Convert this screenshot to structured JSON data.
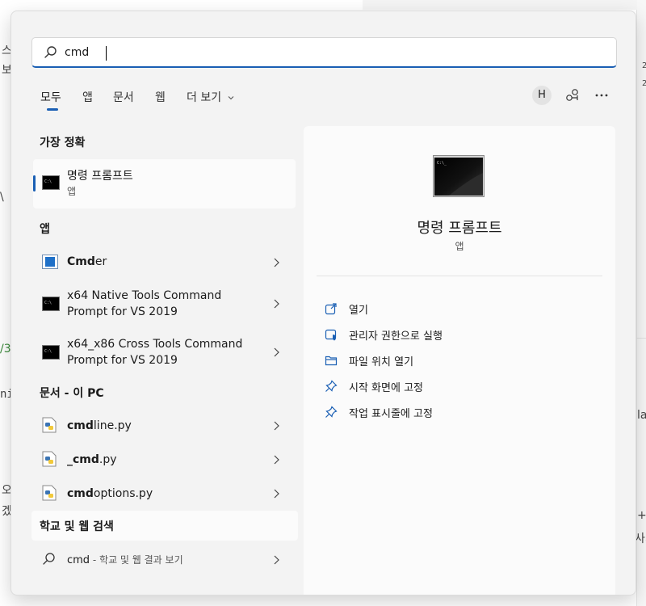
{
  "background": {
    "fragments": [
      "스",
      "보",
      "ni",
      "/3",
      "오",
      "겠",
      "la",
      "+D",
      "사기",
      "\\",
      "2",
      "2"
    ]
  },
  "search": {
    "value": "cmd",
    "placeholder": ""
  },
  "tabs": [
    {
      "label": "모두",
      "active": true
    },
    {
      "label": "앱"
    },
    {
      "label": "문서"
    },
    {
      "label": "웹"
    },
    {
      "label": "더 보기"
    }
  ],
  "toolbar": {
    "avatar_initial": "H"
  },
  "best_match": {
    "section_title": "가장 정확",
    "name": "명령 프롬프트",
    "type": "앱"
  },
  "apps": {
    "section_title": "앱",
    "items": [
      {
        "name_bold": "Cmd",
        "name_rest": "er"
      },
      {
        "line1": "x64 Native Tools Command",
        "line2": "Prompt for VS 2019"
      },
      {
        "line1": "x64_x86 Cross Tools Command",
        "line2": "Prompt for VS 2019"
      }
    ]
  },
  "documents": {
    "section_title": "문서 - 이 PC",
    "items": [
      {
        "bold": "cmd",
        "rest": "line.py",
        "prefix": ""
      },
      {
        "bold": "_cmd",
        "rest": ".py",
        "prefix": ""
      },
      {
        "bold": "cmd",
        "rest": "options.py",
        "prefix": ""
      }
    ]
  },
  "web": {
    "section_title": "학교 및 웹 검색",
    "query": "cmd",
    "suffix": " - 학교 및 웹 결과 보기"
  },
  "detail": {
    "title": "명령 프롬프트",
    "subtitle": "앱",
    "actions": [
      {
        "label": "열기",
        "icon": "open-external-icon"
      },
      {
        "label": "관리자 권한으로 실행",
        "icon": "shield-admin-icon"
      },
      {
        "label": "파일 위치 열기",
        "icon": "folder-icon"
      },
      {
        "label": "시작 화면에 고정",
        "icon": "pin-icon"
      },
      {
        "label": "작업 표시줄에 고정",
        "icon": "pin-icon"
      }
    ]
  },
  "colors": {
    "accent": "#1a5fb4",
    "panel": "#f3f3f3",
    "card": "#fbfbfb"
  }
}
